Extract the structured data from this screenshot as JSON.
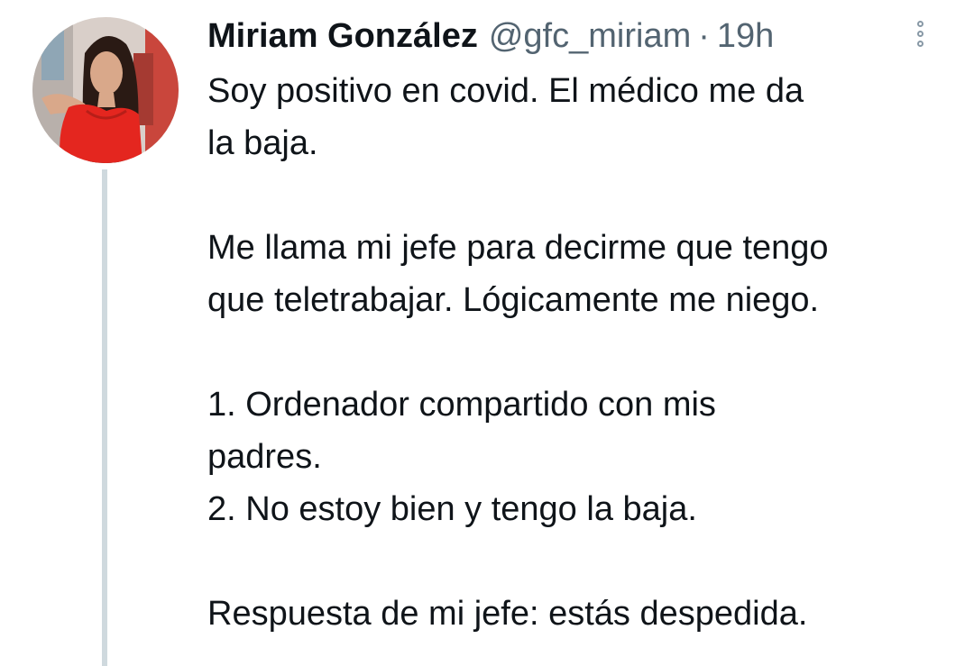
{
  "author": {
    "name": "Miriam González",
    "handle": "@gfc_miriam",
    "separator": "·",
    "time": "19h"
  },
  "icons": {
    "more": "more-vertical-icon",
    "avatar": "profile-photo"
  },
  "colors": {
    "text": "#0f1419",
    "secondary": "#536471",
    "thread_line": "#cfd9de"
  },
  "tweet": {
    "para1": {
      "line1": "Soy positivo en covid. El médico me da",
      "line2": "la baja."
    },
    "para2": {
      "line1": "Me llama mi jefe para decirme que tengo",
      "line2": "que teletrabajar. Lógicamente me niego."
    },
    "para3": {
      "line1": "1. Ordenador compartido con mis",
      "line2": "padres.",
      "line3": "2. No estoy bien y tengo la baja."
    },
    "para4": {
      "line1": "Respuesta de mi jefe: estás despedida."
    }
  }
}
